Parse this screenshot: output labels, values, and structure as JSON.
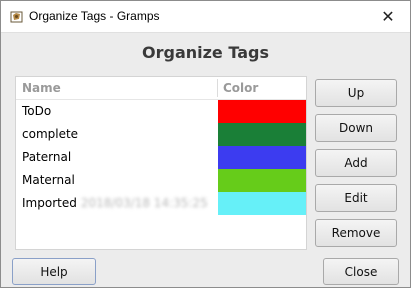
{
  "window": {
    "title": "Organize Tags - Gramps",
    "close_glyph": "✕",
    "icon": "gramps-app-icon"
  },
  "heading": "Organize Tags",
  "list": {
    "columns": [
      "Name",
      "Color"
    ],
    "rows": [
      {
        "name": "ToDo",
        "suffix": "",
        "color": "#ff0000"
      },
      {
        "name": "complete",
        "suffix": "",
        "color": "#1a7f37"
      },
      {
        "name": "Paternal",
        "suffix": "",
        "color": "#3c3cf0"
      },
      {
        "name": "Maternal",
        "suffix": "",
        "color": "#66cc1a"
      },
      {
        "name": "Imported",
        "suffix": "2018/03/18 14:35:25",
        "color": "#66f0f8"
      }
    ]
  },
  "side_buttons": [
    "Up",
    "Down",
    "Add",
    "Edit",
    "Remove"
  ],
  "bottom": {
    "help_label": "Help",
    "close_label": "Close"
  }
}
